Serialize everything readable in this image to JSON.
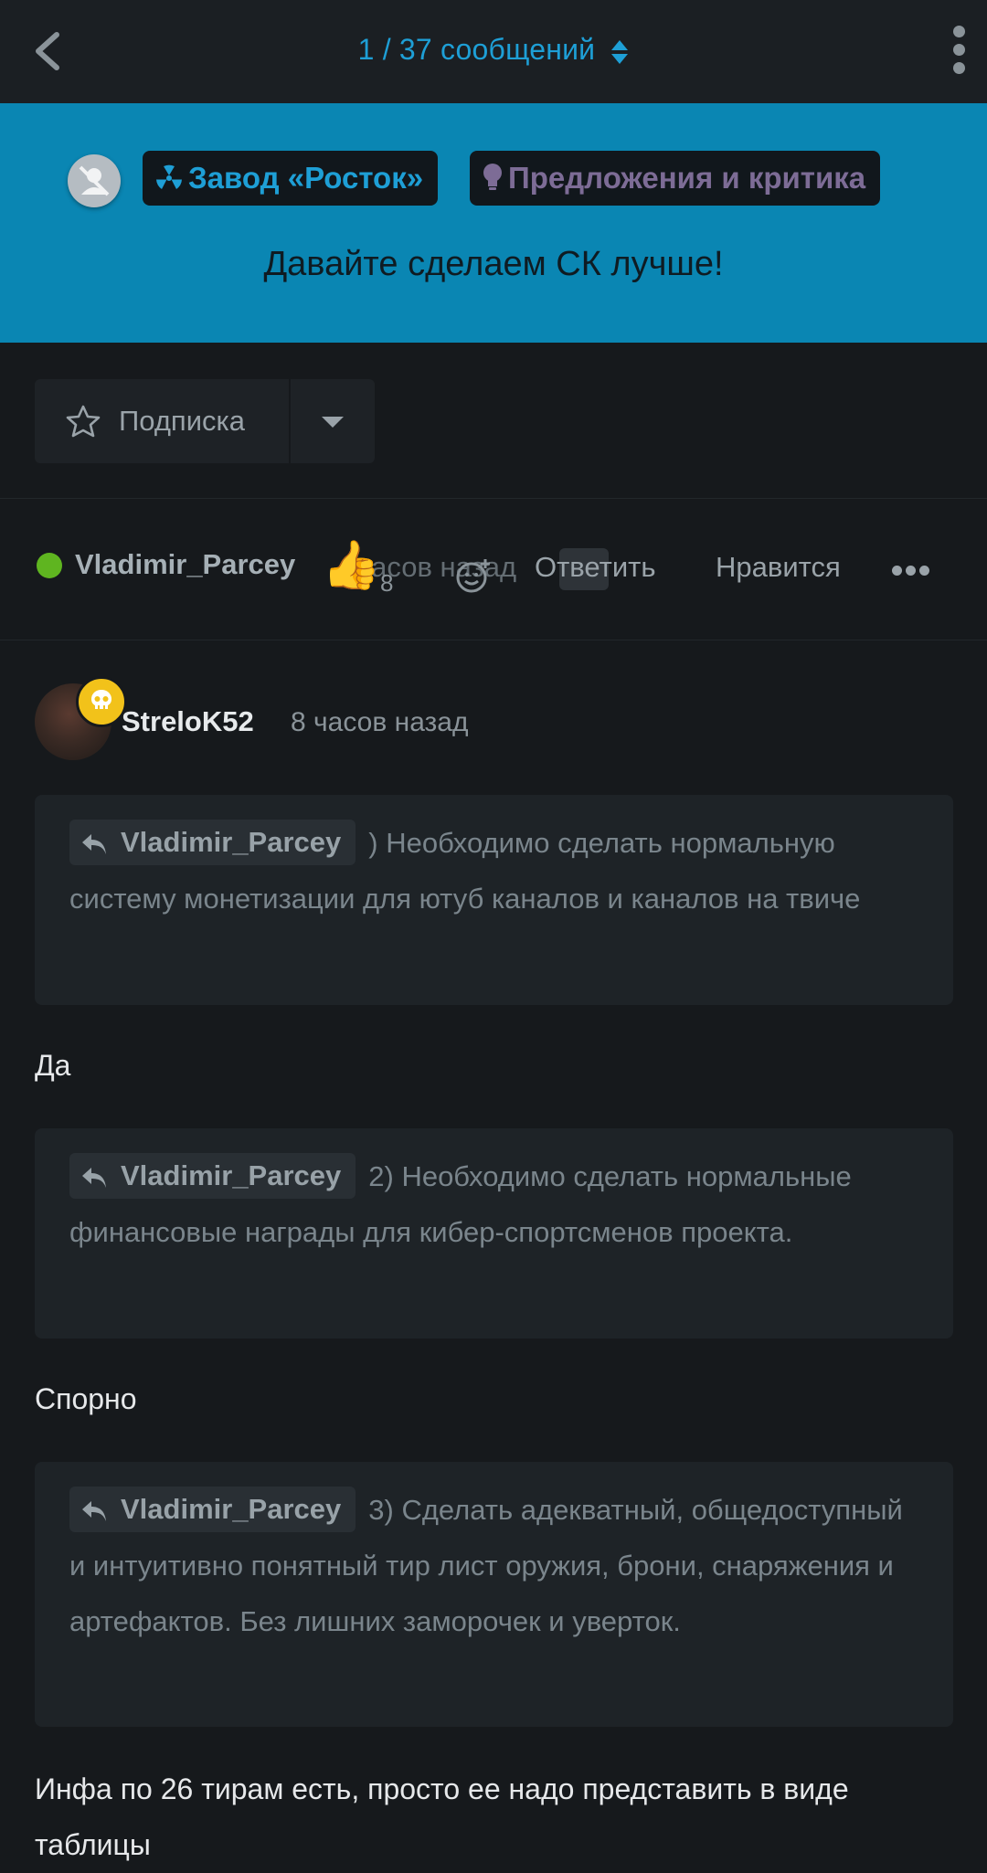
{
  "topbar": {
    "counter": "1 / 37 сообщений"
  },
  "banner": {
    "crumb_category": "Завод «Росток»",
    "crumb_forum": "Предложения и критика",
    "title": "Давайте сделаем СК лучше!"
  },
  "subscribe": {
    "label": "Подписка"
  },
  "op_post": {
    "author": "Vladimir_Parcey",
    "time": "часов назад",
    "likes": "8",
    "reply_label": "Ответить",
    "like_label": "Нравится"
  },
  "post": {
    "author": "StreloK52",
    "time": "8 часов назад",
    "blocks": [
      {
        "quote_author": "Vladimir_Parcey",
        "quote_text": ") Необходимо сделать нормальную систему монетизации для ютуб каналов и каналов на твиче",
        "reply": "Да"
      },
      {
        "quote_author": "Vladimir_Parcey",
        "quote_text": "2) Необходимо сделать нормальные финансовые награды для кибер-спортсменов проекта.",
        "reply": "Спорно"
      },
      {
        "quote_author": "Vladimir_Parcey",
        "quote_text": "3) Сделать адекватный, общедоступный и интуитивно понятный тир лист оружия, брони, снаряжения и артефактов. Без лишних заморочек и уверток.",
        "reply": "Инфа по 26 тирам есть, просто ее надо представить в виде таблицы"
      }
    ]
  },
  "colors": {
    "accent": "#1e9fd6",
    "banner": "#0a86b3",
    "background": "#16191c",
    "online": "#5fb520",
    "badge": "#f2c21a"
  },
  "icons": [
    "back-arrow-icon",
    "sort-icon",
    "more-vertical-icon",
    "no-avatar-icon",
    "radiation-icon",
    "lightbulb-icon",
    "star-icon",
    "chevron-down-icon",
    "thumbs-up-icon",
    "add-reaction-icon",
    "more-horizontal-icon",
    "skull-badge-icon",
    "reply-arrow-icon"
  ]
}
